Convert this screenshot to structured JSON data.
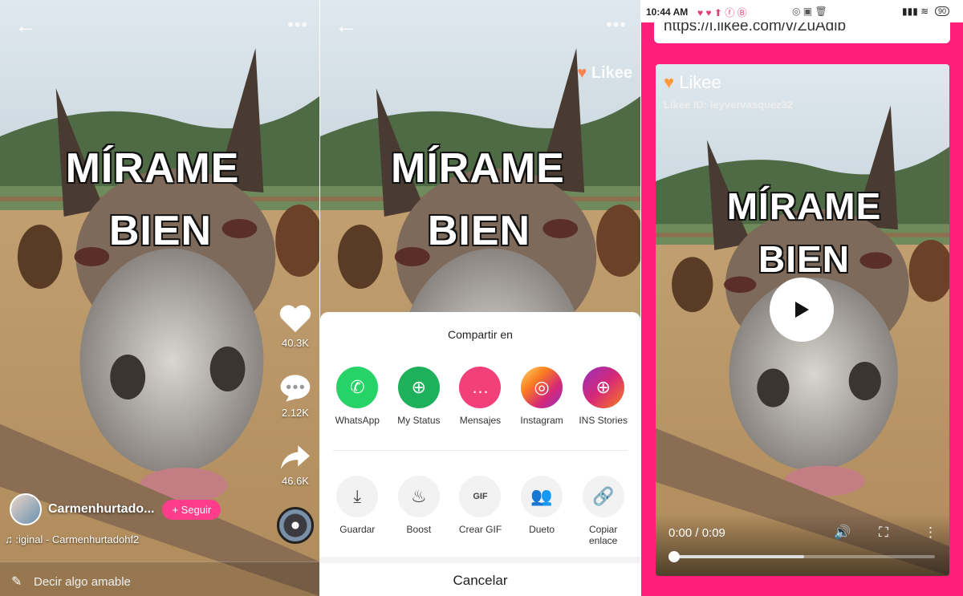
{
  "meme": {
    "line1": "MÍRAME",
    "line2": "BIEN"
  },
  "panel1": {
    "likes": "40.3K",
    "comments": "2.12K",
    "shares": "46.6K",
    "username": "Carmenhurtado...",
    "follow_label": "+ Seguir",
    "music": "♫ :iginal - Carmenhurtadohf2",
    "comment_placeholder": "Decir algo amable"
  },
  "panel2": {
    "watermark": "Likee",
    "sheet_title": "Compartir en",
    "share_targets": [
      {
        "label": "WhatsApp",
        "color": "#25d366",
        "icon": "whatsapp-icon"
      },
      {
        "label": "My Status",
        "color": "#1fb05b",
        "icon": "status-icon"
      },
      {
        "label": "Mensajes",
        "color": "#f2407a",
        "icon": "messages-icon"
      },
      {
        "label": "Instagram",
        "color": "#d6249f",
        "icon": "instagram-icon"
      },
      {
        "label": "INS Stories",
        "color": "#c5216e",
        "icon": "ins-stories-icon"
      }
    ],
    "actions": [
      {
        "label": "Guardar",
        "icon": "download-icon"
      },
      {
        "label": "Boost",
        "icon": "flame-icon"
      },
      {
        "label": "Crear GIF",
        "icon": "gif-icon"
      },
      {
        "label": "Dueto",
        "icon": "duet-icon"
      },
      {
        "label": "Copiar enlace",
        "icon": "link-icon"
      }
    ],
    "cancel_label": "Cancelar"
  },
  "panel3": {
    "status_time": "10:44 AM",
    "battery": "90",
    "url": "https://l.likee.com/v/ZuAdib",
    "logo": "Likee",
    "likee_id": "Likee ID: leyvervasquez32",
    "time": "0:00 / 0:09",
    "progress": 0.5
  },
  "colors": {
    "accent": "#ff3d8a",
    "frame": "#ff1f7a"
  }
}
